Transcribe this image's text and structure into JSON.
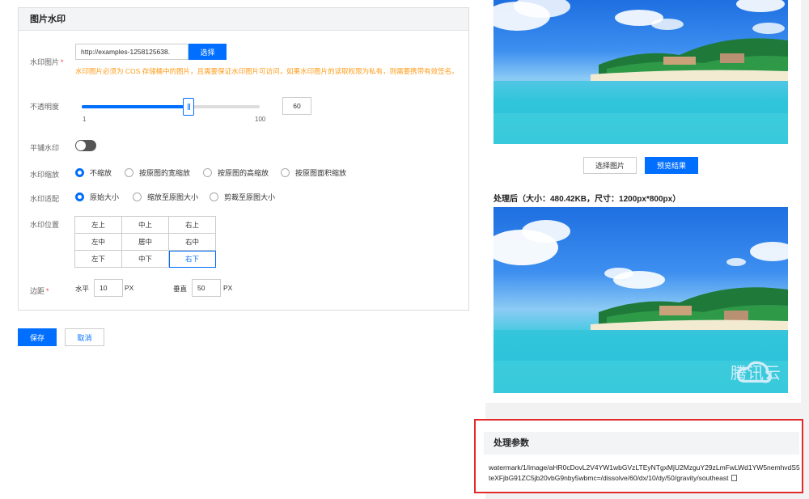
{
  "panel": {
    "title": "图片水印"
  },
  "form": {
    "watermark_image": {
      "label": "水印图片",
      "required_mark": "*",
      "value": "http://examples-1258125638.",
      "select_button": "选择",
      "warning": "水印图片必须为 COS 存储桶中的图片，且需要保证水印图片可访问，如果水印图片的读取权限为私有，则需要携带有效签名。"
    },
    "opacity": {
      "label": "不透明度",
      "value": "60",
      "percent": 60,
      "min_label": "1",
      "max_label": "100"
    },
    "tile": {
      "label": "平铺水印",
      "on": false
    },
    "scale": {
      "label": "水印缩放",
      "options": [
        "不缩放",
        "按原图的宽缩放",
        "按原图的高缩放",
        "按原图面积缩放"
      ],
      "selected": 0
    },
    "fit": {
      "label": "水印适配",
      "options": [
        "原始大小",
        "缩放至原图大小",
        "剪裁至原图大小"
      ],
      "selected": 0
    },
    "position": {
      "label": "水印位置",
      "cells": [
        "左上",
        "中上",
        "右上",
        "左中",
        "居中",
        "右中",
        "左下",
        "中下",
        "右下"
      ],
      "selected": 8
    },
    "margin": {
      "label": "边距",
      "required_mark": "*",
      "horizontal_label": "水平",
      "horizontal_value": "10",
      "vertical_label": "垂直",
      "vertical_value": "50",
      "unit": "PX"
    }
  },
  "actions": {
    "save": "保存",
    "cancel": "取消"
  },
  "preview": {
    "choose_image": "选择图片",
    "preview_result": "预览结果",
    "result_title": "处理后（大小：480.42KB，尺寸：1200px*800px）",
    "watermark_text": "腾讯云"
  },
  "params": {
    "title": "处理参数",
    "text": "watermark/1/image/aHR0cDovL2V4YW1wbGVzLTEyNTgxMjU2MzguY29zLmFwLWd1YW5nemhvdS5teXFjbG91ZC5jb20vbG9nby5wbmc=/dissolve/60/dx/10/dy/50/gravity/southeast"
  },
  "colors": {
    "primary": "#006eff",
    "warning": "#ff9c19",
    "highlight_border": "#e32a2a"
  }
}
